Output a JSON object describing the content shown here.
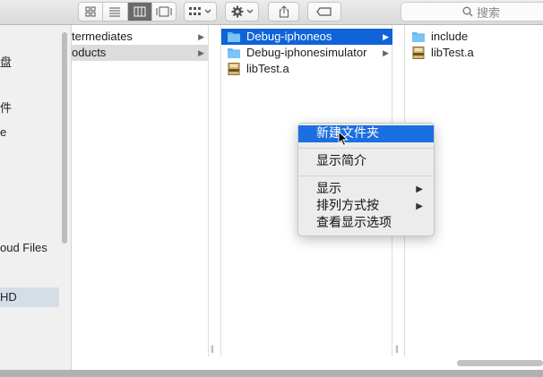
{
  "toolbar": {
    "view_buttons": [
      "icon-view",
      "list-view",
      "column-view",
      "gallery-view"
    ],
    "active_view": "column-view",
    "search_placeholder": "搜索"
  },
  "sidebar": {
    "items": [
      {
        "label": "盘"
      },
      {
        "label": "件"
      },
      {
        "label": "e"
      },
      {
        "label": "oud Files"
      },
      {
        "label": "HD"
      }
    ]
  },
  "columns": {
    "col1": [
      {
        "label": "termediates"
      },
      {
        "label": "oducts"
      }
    ],
    "col2": [
      {
        "label": "Debug-iphoneos"
      },
      {
        "label": "Debug-iphonesimulator"
      },
      {
        "label": "libTest.a"
      }
    ],
    "col3": [
      {
        "label": "include"
      },
      {
        "label": "libTest.a"
      }
    ]
  },
  "context_menu": {
    "items": [
      {
        "label": "新建文件夹"
      },
      {
        "label": "显示简介"
      },
      {
        "label": "显示"
      },
      {
        "label": "排列方式按"
      },
      {
        "label": "查看显示选项"
      }
    ]
  },
  "colors": {
    "selection_blue": "#0f63d8",
    "menu_highlight": "#1b6fe0",
    "folder_blue": "#5aaef0"
  }
}
